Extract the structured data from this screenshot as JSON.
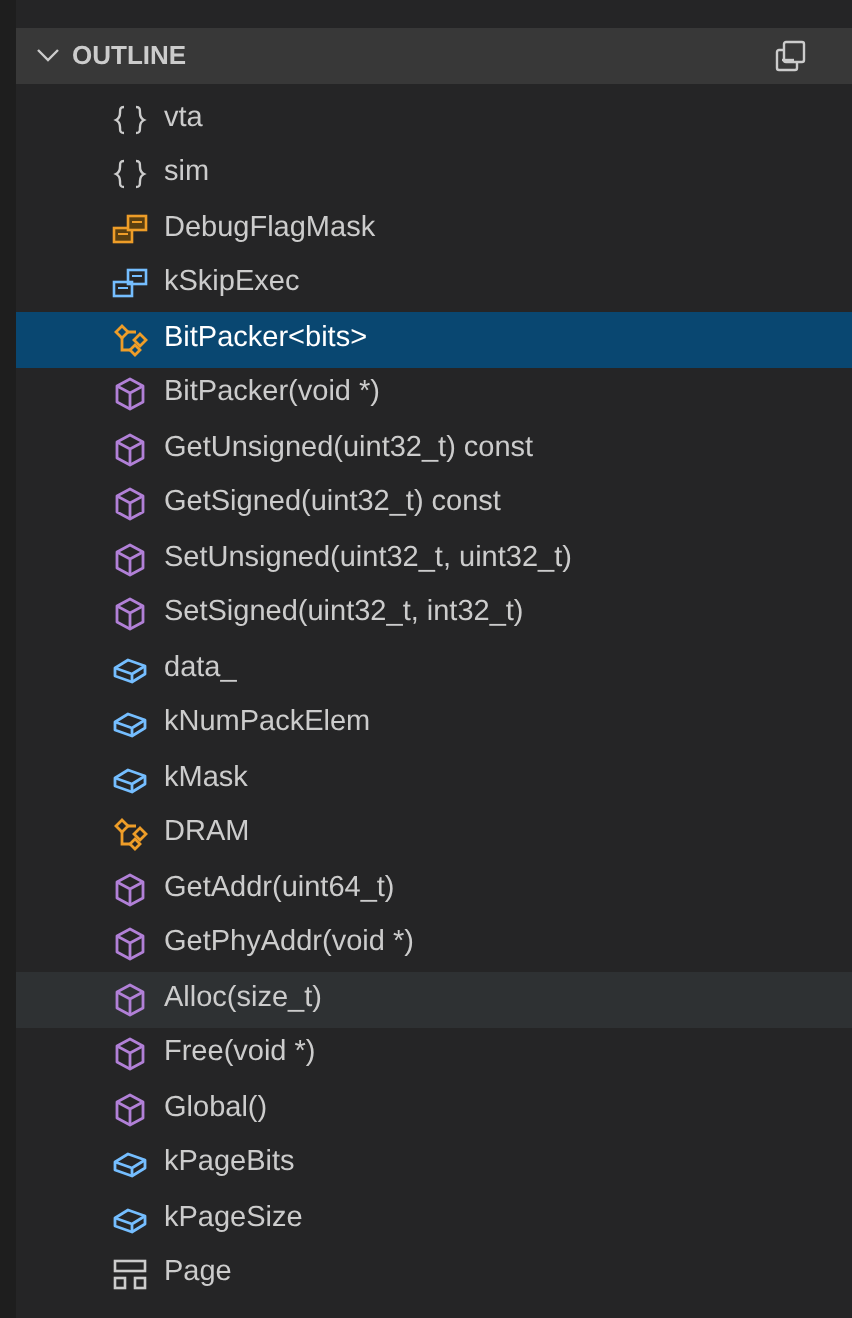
{
  "panel": {
    "title": "OUTLINE",
    "expanded": true
  },
  "items": [
    {
      "label": "vta",
      "kind": "namespace",
      "selected": false,
      "hovered": false
    },
    {
      "label": "sim",
      "kind": "namespace",
      "selected": false,
      "hovered": false
    },
    {
      "label": "DebugFlagMask",
      "kind": "enum",
      "selected": false,
      "hovered": false
    },
    {
      "label": "kSkipExec",
      "kind": "enummember",
      "selected": false,
      "hovered": false
    },
    {
      "label": "BitPacker<bits>",
      "kind": "class",
      "selected": true,
      "hovered": false
    },
    {
      "label": "BitPacker(void *)",
      "kind": "method",
      "selected": false,
      "hovered": false
    },
    {
      "label": "GetUnsigned(uint32_t) const",
      "kind": "method",
      "selected": false,
      "hovered": false
    },
    {
      "label": "GetSigned(uint32_t) const",
      "kind": "method",
      "selected": false,
      "hovered": false
    },
    {
      "label": "SetUnsigned(uint32_t, uint32_t)",
      "kind": "method",
      "selected": false,
      "hovered": false
    },
    {
      "label": "SetSigned(uint32_t, int32_t)",
      "kind": "method",
      "selected": false,
      "hovered": false
    },
    {
      "label": "data_",
      "kind": "field",
      "selected": false,
      "hovered": false
    },
    {
      "label": "kNumPackElem",
      "kind": "field",
      "selected": false,
      "hovered": false
    },
    {
      "label": "kMask",
      "kind": "field",
      "selected": false,
      "hovered": false
    },
    {
      "label": "DRAM",
      "kind": "class",
      "selected": false,
      "hovered": false
    },
    {
      "label": "GetAddr(uint64_t)",
      "kind": "method",
      "selected": false,
      "hovered": false
    },
    {
      "label": "GetPhyAddr(void *)",
      "kind": "method",
      "selected": false,
      "hovered": false
    },
    {
      "label": "Alloc(size_t)",
      "kind": "method",
      "selected": false,
      "hovered": true
    },
    {
      "label": "Free(void *)",
      "kind": "method",
      "selected": false,
      "hovered": false
    },
    {
      "label": "Global()",
      "kind": "method",
      "selected": false,
      "hovered": false
    },
    {
      "label": "kPageBits",
      "kind": "field",
      "selected": false,
      "hovered": false
    },
    {
      "label": "kPageSize",
      "kind": "field",
      "selected": false,
      "hovered": false
    },
    {
      "label": "Page",
      "kind": "struct",
      "selected": false,
      "hovered": false
    }
  ]
}
